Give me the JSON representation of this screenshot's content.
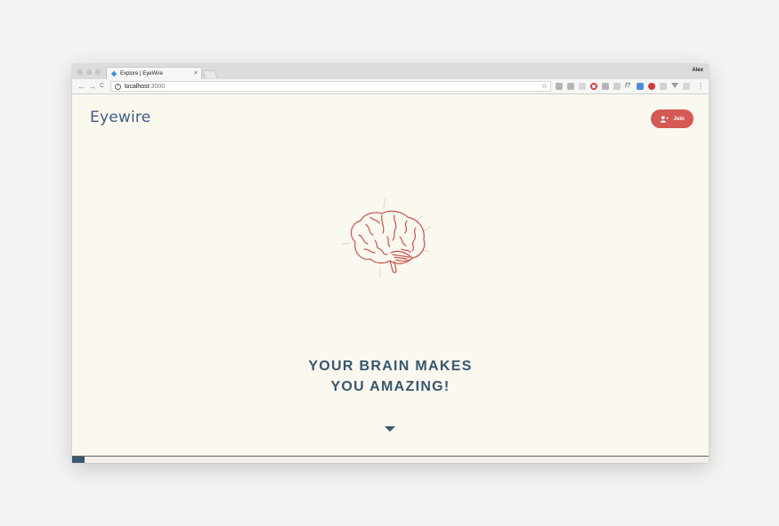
{
  "browser": {
    "tab_title": "Explore | EyeWire",
    "tab_close": "×",
    "profile_name": "Alex",
    "url_host": "localhost",
    "url_port": ":3000",
    "back": "←",
    "forward": "→",
    "reload": "C",
    "star": "☆",
    "menu": "⋮",
    "info": "i",
    "extensions": [
      "extension-1",
      "extension-2",
      "extension-3",
      "opera-icon",
      "extension-5",
      "extension-6",
      "fx-icon",
      "calendar-icon",
      "pinterest-icon",
      "extension-10",
      "filter-icon",
      "extension-12"
    ]
  },
  "site": {
    "logo_text": "Eyewire",
    "join_label": "Join",
    "headline_line1": "YOUR BRAIN MAKES",
    "headline_line2": "YOU AMAZING!"
  },
  "progress": {
    "fraction": 0.02
  },
  "colors": {
    "accent": "#d35a55",
    "brand_blue": "#37576e",
    "page_bg": "#fbf8f0"
  }
}
